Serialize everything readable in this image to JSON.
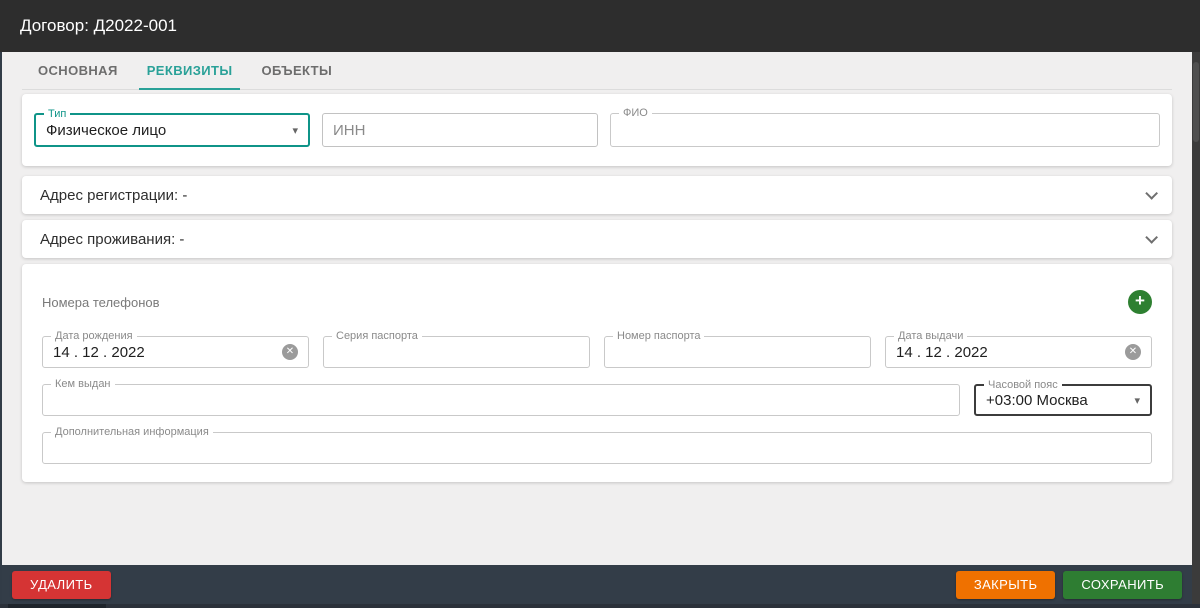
{
  "header": {
    "title": "Договор: Д2022-001"
  },
  "tabs": [
    {
      "label": "ОСНОВНАЯ",
      "active": false
    },
    {
      "label": "РЕКВИЗИТЫ",
      "active": true
    },
    {
      "label": "ОБЪЕКТЫ",
      "active": false
    }
  ],
  "form": {
    "type_field": {
      "label": "Тип",
      "value": "Физическое лицо"
    },
    "inn_field": {
      "placeholder": "ИНН"
    },
    "fio_field": {
      "label": "ФИО",
      "value": ""
    },
    "accordions": [
      {
        "label": "Адрес регистрации: -"
      },
      {
        "label": "Адрес проживания: -"
      }
    ],
    "phones_label": "Номера телефонов",
    "birth_date": {
      "label": "Дата рождения",
      "value": "14 . 12 . 2022"
    },
    "passport_series": {
      "label": "Серия паспорта",
      "value": ""
    },
    "passport_number": {
      "label": "Номер паспорта",
      "value": ""
    },
    "issue_date": {
      "label": "Дата выдачи",
      "value": "14 . 12 . 2022"
    },
    "issued_by": {
      "label": "Кем выдан",
      "value": ""
    },
    "timezone": {
      "label": "Часовой пояс",
      "value": "+03:00 Москва"
    },
    "extra_info": {
      "label": "Дополнительная информация",
      "value": ""
    }
  },
  "icons": {
    "dropdown_caret": "▾",
    "clear": "✕",
    "add": "+"
  },
  "footer": {
    "delete_label": "УДАЛИТЬ",
    "close_label": "ЗАКРЫТЬ",
    "save_label": "СОХРАНИТЬ"
  },
  "colors": {
    "accent_teal": "#0f9488",
    "header_bg": "#2d2d2d",
    "footer_bg": "#333d48",
    "delete_red": "#d53434",
    "close_orange": "#ef7100",
    "save_green": "#2e7d32",
    "add_green": "#2e8031",
    "page_bg": "#f0efef"
  }
}
